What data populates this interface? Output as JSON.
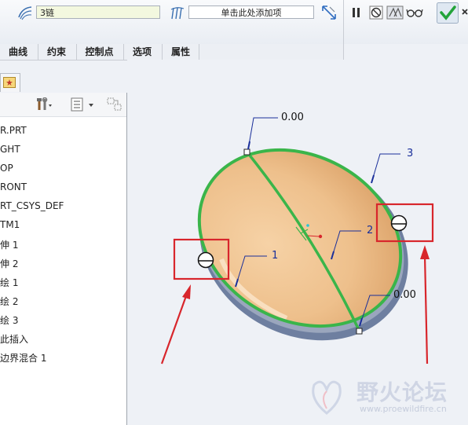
{
  "toolbar": {
    "chain_field_value": "3链",
    "add_item_field_value": "单击此处添加项"
  },
  "tabs": [
    {
      "label": "曲线"
    },
    {
      "label": "约束"
    },
    {
      "label": "控制点"
    },
    {
      "label": "选项"
    },
    {
      "label": "属性"
    }
  ],
  "tree": {
    "items": [
      {
        "label": "R.PRT"
      },
      {
        "label": "GHT"
      },
      {
        "label": "OP"
      },
      {
        "label": "RONT"
      },
      {
        "label": "RT_CSYS_DEF"
      },
      {
        "label": "TM1"
      },
      {
        "label": "伸 1"
      },
      {
        "label": "伸 2"
      },
      {
        "label": "绘 1"
      },
      {
        "label": "绘 2"
      },
      {
        "label": "绘 3"
      },
      {
        "label": "此插入"
      },
      {
        "label": "边界混合 1"
      }
    ]
  },
  "viewport": {
    "dimension_top": "0.00",
    "dimension_bottom": "0.00",
    "label_1": "1",
    "label_2": "2",
    "label_3": "3"
  },
  "watermark": {
    "title": "野火论坛",
    "url": "www.proewildfire.cn"
  },
  "colors": {
    "accent_green": "#3ab54a",
    "highlight_red": "#d8262c",
    "dimension_blue": "#1a2f9a",
    "surface": "#f0c79b"
  }
}
